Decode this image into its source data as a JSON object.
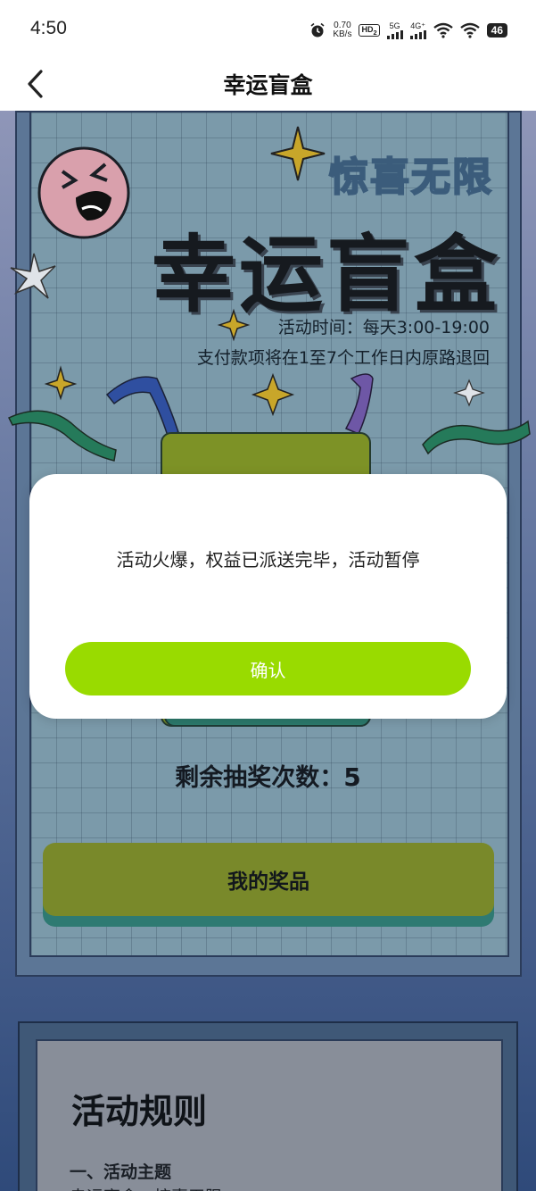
{
  "status_bar": {
    "time": "4:50",
    "net_speed_value": "0.70",
    "net_speed_unit": "KB/s",
    "hd_label": "HD",
    "hd_sub": "2",
    "sim1": "5G",
    "sim2": "4G⁺",
    "battery": "46"
  },
  "nav": {
    "title": "幸运盲盒",
    "back_icon": "chevron-left-icon"
  },
  "poster": {
    "tagline": "惊喜无限",
    "hero_title": "幸运盲盒",
    "activity_time": "活动时间：每天3:00-19:00",
    "refund_note": "支付款项将在1至7个工作日内原路退回",
    "remaining_label": "剩余抽奖次数：",
    "remaining_count": "5",
    "my_prizes_button": "我的奖品"
  },
  "rules": {
    "title": "活动规则",
    "section1_heading": "一、活动主题",
    "section1_line": "幸运盲盒，惊喜无限"
  },
  "modal": {
    "message": "活动火爆，权益已派送完毕，活动暂停",
    "confirm_button": "确认"
  },
  "colors": {
    "accent_green": "#99db00",
    "prize_button": "#79892a",
    "box_teal": "#2c7a6c"
  }
}
